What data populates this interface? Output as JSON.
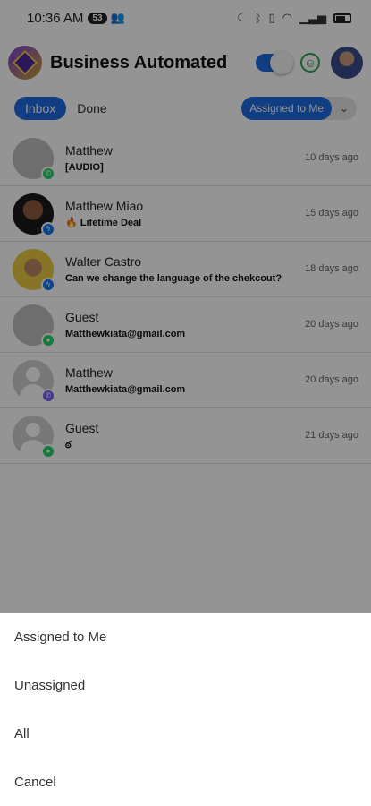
{
  "status_bar": {
    "time": "10:36 AM",
    "notification_count": "53"
  },
  "header": {
    "title": "Business Automated",
    "logo_icon": "cube-logo-icon",
    "toggle_on": true
  },
  "tabs": {
    "inbox": "Inbox",
    "done": "Done",
    "assigned_filter": "Assigned to Me"
  },
  "conversations": [
    {
      "name": "Matthew",
      "message": "[AUDIO]",
      "time": "10 days ago",
      "channel": "whatsapp"
    },
    {
      "name": "Matthew Miao",
      "message": "🔥 Lifetime Deal",
      "time": "15 days ago",
      "channel": "messenger"
    },
    {
      "name": "Walter Castro",
      "message": "Can we change the language of the chekcout?",
      "time": "18 days ago",
      "channel": "messenger"
    },
    {
      "name": "Guest",
      "message": "Matthewkiata@gmail.com",
      "time": "20 days ago",
      "channel": "wechat"
    },
    {
      "name": "Matthew",
      "message": "Matthewkiata@gmail.com",
      "time": "20 days ago",
      "channel": "viber"
    },
    {
      "name": "Guest",
      "message": "ఠ",
      "time": "21 days ago",
      "channel": "wechat"
    }
  ],
  "sheet": {
    "items": [
      "Assigned to Me",
      "Unassigned",
      "All",
      "Cancel"
    ]
  }
}
